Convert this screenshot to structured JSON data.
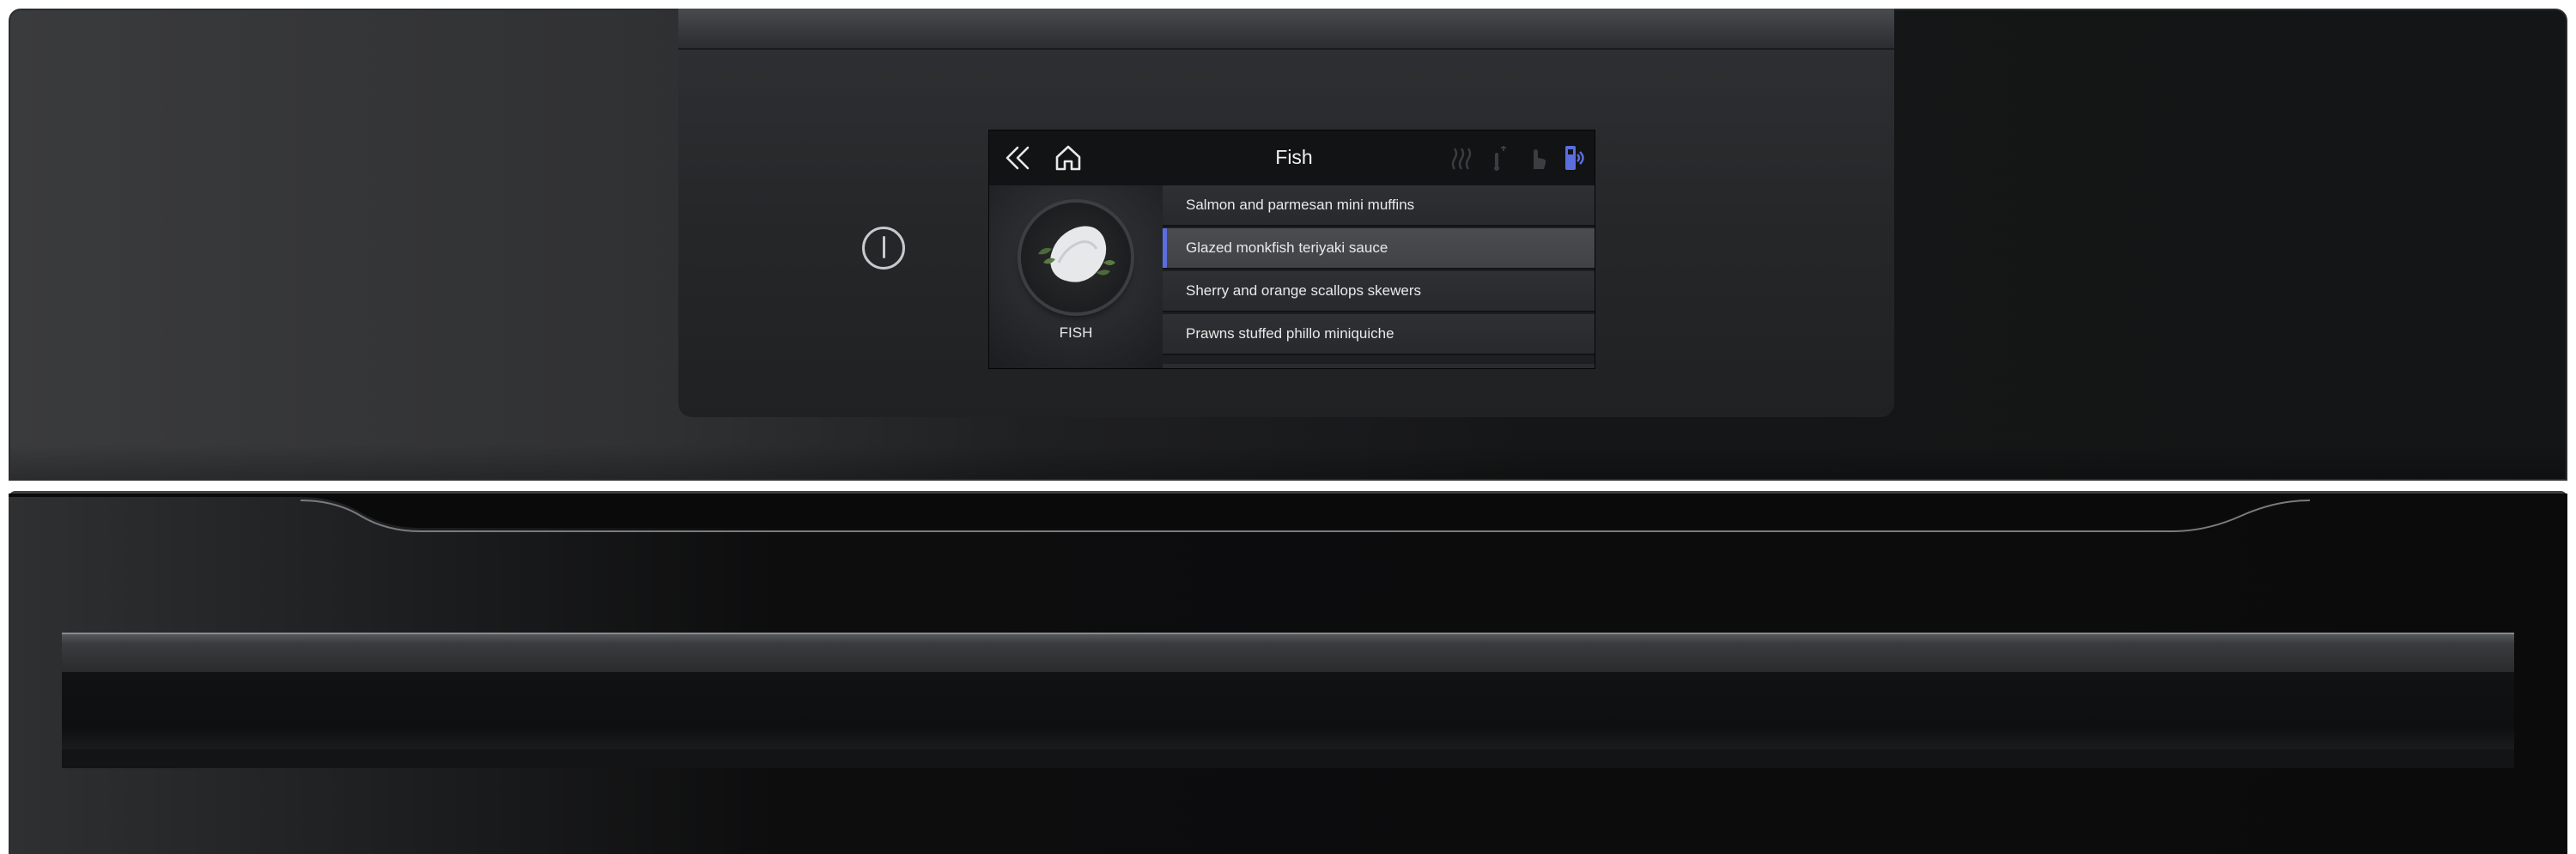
{
  "screen": {
    "title": "Fish",
    "category_label": "FISH",
    "recipes": [
      {
        "label": "Salmon and parmesan mini muffins",
        "selected": false
      },
      {
        "label": "Glazed monkfish teriyaki sauce",
        "selected": true
      },
      {
        "label": "Sherry and orange scallops skewers",
        "selected": false
      },
      {
        "label": "Prawns stuffed phillo miniquiche",
        "selected": false
      }
    ],
    "header_icons": [
      "back-double-chevron-icon",
      "home-icon"
    ],
    "status_icons": [
      "steam-icon",
      "temperature-probe-icon",
      "touch-hand-icon",
      "wifi-connect-icon"
    ]
  },
  "colors": {
    "accent": "#5b6ee0",
    "screen_bg": "#0f1011",
    "appliance_body": "#141516"
  }
}
